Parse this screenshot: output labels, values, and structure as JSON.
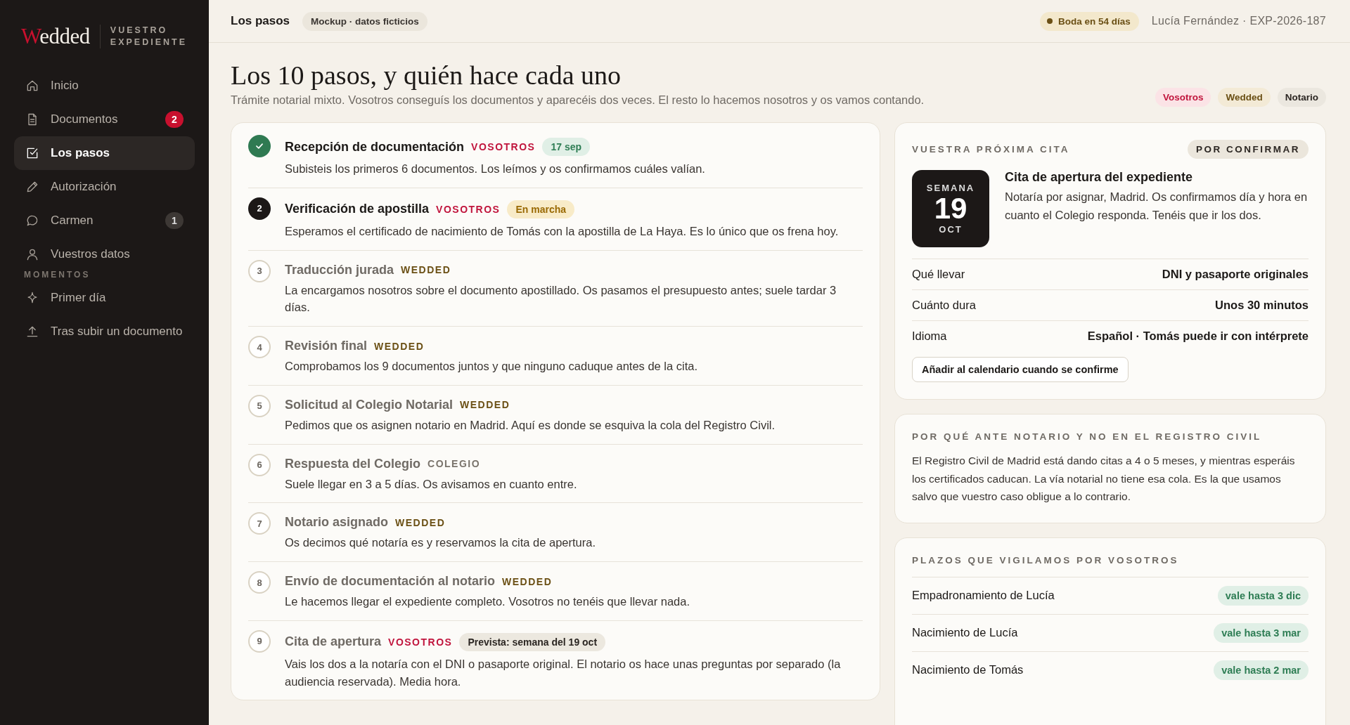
{
  "sidebar": {
    "logo_initial": "W",
    "logo_rest": "edded",
    "subtitle": "VUESTRO EXPEDIENTE",
    "nav": [
      {
        "label": "Inicio",
        "selected": false
      },
      {
        "label": "Documentos",
        "selected": false,
        "badge": {
          "text": "2",
          "kind": "alert"
        }
      },
      {
        "label": "Los pasos",
        "selected": true
      },
      {
        "label": "Autorización",
        "selected": false
      },
      {
        "label": "Carmen",
        "selected": false,
        "badge": {
          "text": "1",
          "kind": "count"
        }
      },
      {
        "label": "Vuestros datos",
        "selected": false
      }
    ],
    "section_title": "MOMENTOS",
    "moments": [
      {
        "label": "Primer día",
        "selected": false
      },
      {
        "label": "Tras subir un documento",
        "selected": false
      }
    ]
  },
  "topbar": {
    "title": "Los pasos",
    "mockup_badge": "Mockup · datos ficticios",
    "countdown": "Boda en 54 días",
    "case": "Lucía Fernández · EXP-2026-187"
  },
  "heading": {
    "title": "Los 10 pasos, y quién hace cada uno",
    "subtitle": "Trámite notarial mixto. Vosotros conseguís los documentos y aparecéis dos veces. El resto lo hacemos nosotros y os vamos contando.",
    "legend": [
      {
        "label": "Vosotros",
        "kind": "vosotros"
      },
      {
        "label": "Wedded",
        "kind": "wedded"
      },
      {
        "label": "Notario",
        "kind": "notario"
      }
    ]
  },
  "steps": [
    {
      "kind": "done",
      "title": "Recepción de documentación",
      "actor": {
        "label": "VOSOTROS",
        "kind": "vosotros"
      },
      "tag": {
        "text": "17 sep",
        "kind": "date"
      },
      "description": "Subisteis los primeros 6 documentos. Los leímos y os confirmamos cuáles valían."
    },
    {
      "kind": "current",
      "number": "2",
      "title": "Verificación de apostilla",
      "actor": {
        "label": "VOSOTROS",
        "kind": "vosotros"
      },
      "tag": {
        "text": "En marcha",
        "kind": "progress"
      },
      "description": "Esperamos el certificado de nacimiento de Tomás con la apostilla de La Haya. Es lo único que os frena hoy."
    },
    {
      "kind": "pending",
      "number": "3",
      "title": "Traducción jurada",
      "actor": {
        "label": "WEDDED",
        "kind": "wedded"
      },
      "description": "La encargamos nosotros sobre el documento apostillado. Os pasamos el presupuesto antes; suele tardar 3 días."
    },
    {
      "kind": "pending",
      "number": "4",
      "title": "Revisión final",
      "actor": {
        "label": "WEDDED",
        "kind": "wedded"
      },
      "description": "Comprobamos los 9 documentos juntos y que ninguno caduque antes de la cita."
    },
    {
      "kind": "pending",
      "number": "5",
      "title": "Solicitud al Colegio Notarial",
      "actor": {
        "label": "WEDDED",
        "kind": "wedded"
      },
      "description": "Pedimos que os asignen notario en Madrid. Aquí es donde se esquiva la cola del Registro Civil."
    },
    {
      "kind": "pending",
      "number": "6",
      "title": "Respuesta del Colegio",
      "actor": {
        "label": "COLEGIO",
        "kind": "colegio"
      },
      "description": "Suele llegar en 3 a 5 días. Os avisamos en cuanto entre."
    },
    {
      "kind": "pending",
      "number": "7",
      "title": "Notario asignado",
      "actor": {
        "label": "WEDDED",
        "kind": "wedded"
      },
      "description": "Os decimos qué notaría es y reservamos la cita de apertura."
    },
    {
      "kind": "pending",
      "number": "8",
      "title": "Envío de documentación al notario",
      "actor": {
        "label": "WEDDED",
        "kind": "wedded"
      },
      "description": "Le hacemos llegar el expediente completo. Vosotros no tenéis que llevar nada."
    },
    {
      "kind": "pending",
      "number": "9",
      "title": "Cita de apertura",
      "actor": {
        "label": "VOSOTROS",
        "kind": "vosotros"
      },
      "tag": {
        "text": "Prevista: semana del 19 oct",
        "kind": "planned"
      },
      "description": "Vais los dos a la notaría con el DNI o pasaporte original. El notario os hace unas preguntas por separado (la audiencia reservada). Media hora."
    }
  ],
  "appointment": {
    "heading": "VUESTRA PRÓXIMA CITA",
    "status": "POR CONFIRMAR",
    "date_top": "SEMANA",
    "date_day": "19",
    "date_month": "OCT",
    "title": "Cita de apertura del expediente",
    "description": "Notaría por asignar, Madrid. Os confirmamos día y hora en cuanto el Colegio responda. Tenéis que ir los dos.",
    "details": [
      {
        "label": "Qué llevar",
        "value": "DNI y pasaporte originales"
      },
      {
        "label": "Cuánto dura",
        "value": "Unos 30 minutos"
      },
      {
        "label": "Idioma",
        "value": "Español · Tomás puede ir con intérprete"
      }
    ],
    "button": "Añadir al calendario cuando se confirme"
  },
  "why": {
    "heading": "POR QUÉ ANTE NOTARIO Y NO EN EL REGISTRO CIVIL",
    "text": "El Registro Civil de Madrid está dando citas a 4 o 5 meses, y mientras esperáis los certificados caducan. La vía notarial no tiene esa cola. Es la que usamos salvo que vuestro caso obligue a lo contrario."
  },
  "deadlines": {
    "heading": "PLAZOS QUE VIGILAMOS POR VOSOTROS",
    "items": [
      {
        "label": "Empadronamiento de Lucía",
        "validity": "vale hasta 3 dic"
      },
      {
        "label": "Nacimiento de Lucía",
        "validity": "vale hasta 3 mar"
      },
      {
        "label": "Nacimiento de Tomás",
        "validity": "vale hasta 2 mar"
      }
    ]
  }
}
